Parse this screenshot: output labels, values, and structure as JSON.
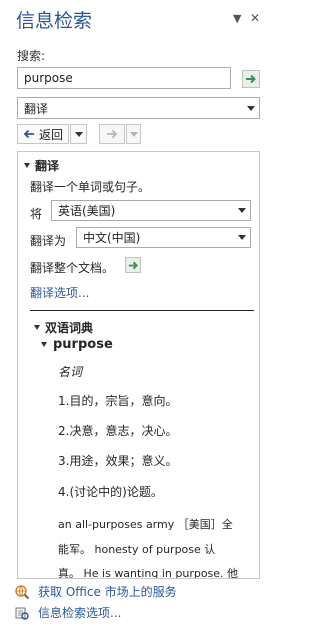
{
  "pane": {
    "title": "信息检索",
    "menu_glyph": "▼",
    "close_glyph": "✕"
  },
  "search": {
    "label": "搜索:",
    "value": "purpose",
    "service": "翻译"
  },
  "nav": {
    "back_label": "返回"
  },
  "section": {
    "title": "翻译",
    "instruction": "翻译一个单词或句子。",
    "from_label": "将",
    "from_lang": "英语(美国)",
    "to_label": "翻译为",
    "to_lang": "中文(中国)",
    "whole_doc_label": "翻译整个文档。",
    "options_link": "翻译选项..."
  },
  "dictionary": {
    "title": "双语词典",
    "headword": "purpose",
    "pos": "名词",
    "senses": [
      "1.目的，宗旨，意向。",
      "2.决意，意志，决心。",
      "3.用途，效果；意义。",
      "4.(讨论中的)论题。"
    ],
    "example_line1": "an all-purposes army ［美国］全",
    "example_line2": "能军。 honesty of purpose 认",
    "example_line3": "真。 He is wanting in purpose. 他"
  },
  "footer": {
    "market_link": "获取 Office 市场上的服务",
    "options_link": "信息检索选项..."
  },
  "colors": {
    "title": "#2b579a",
    "go_arrow": "#3c8f56",
    "link": "#2b579a"
  }
}
